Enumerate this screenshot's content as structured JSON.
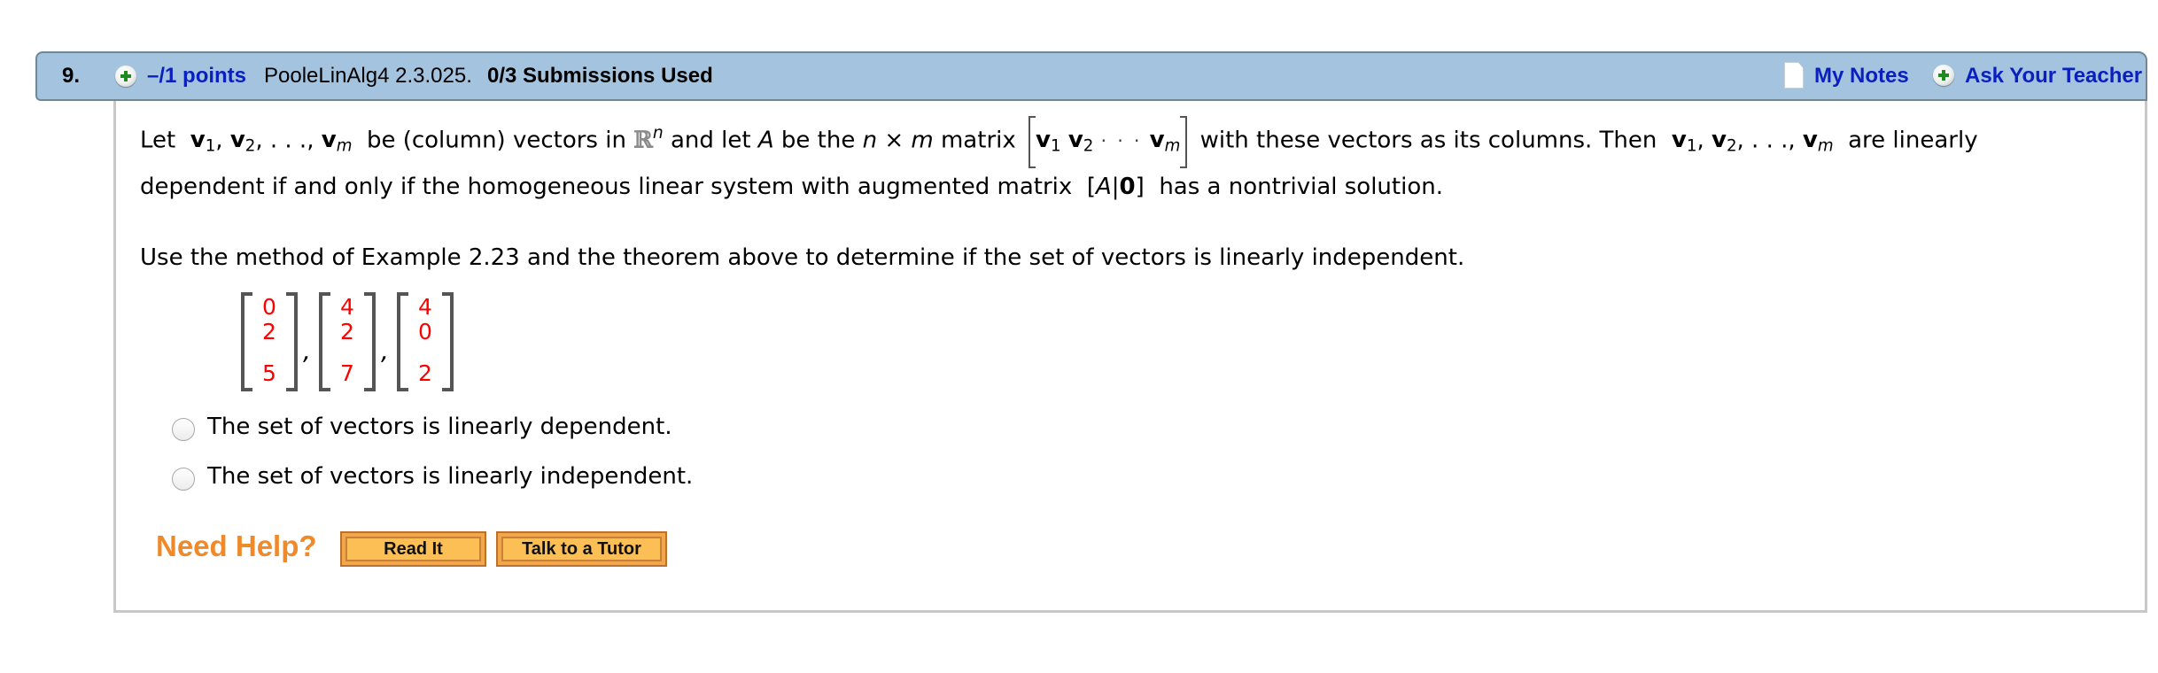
{
  "question": {
    "number": "9.",
    "points": "–/1 points",
    "reference": "PooleLinAlg4 2.3.025.",
    "submissions": "0/3 Submissions Used",
    "my_notes": "My Notes",
    "ask_teacher": "Ask Your Teacher"
  },
  "body": {
    "l1": {
      "let": "Let",
      "v": "v",
      "sub1": "1",
      "sub2": "2",
      "subm": "m",
      "comma": ",",
      "ellipsis": ". . .",
      "be_column": "be (column) vectors in",
      "R": "ℝ",
      "n": "n",
      "and_let": "and let",
      "A": "A",
      "be_the": "be the",
      "n2": "n",
      "times": "×",
      "m": "m",
      "matrix": "matrix",
      "cdots": "· · ·",
      "with_these": "with these vectors as its columns. Then",
      "are_linearly": "are linearly"
    },
    "l2": {
      "text1": "dependent if and only if the homogeneous linear system with augmented matrix",
      "open": "[",
      "A": "A",
      "bar": "|",
      "zero": "0",
      "close": "]",
      "text2": "has a nontrivial solution."
    },
    "l3": "Use the method of Example 2.23 and the theorem above to determine if the set of vectors is linearly independent.",
    "vectors": [
      [
        "0",
        "2",
        "5"
      ],
      [
        "4",
        "2",
        "7"
      ],
      [
        "4",
        "0",
        "2"
      ]
    ],
    "vector_separator": ",",
    "options": [
      {
        "label": "The set of vectors is linearly dependent.",
        "selected": false
      },
      {
        "label": "The set of vectors is linearly independent.",
        "selected": false
      }
    ]
  },
  "help": {
    "label": "Need Help?",
    "read_it": "Read It",
    "tutor": "Talk to a Tutor"
  },
  "colors": {
    "header_bg": "#a3c3de",
    "link": "#0a1fbf",
    "vector_entry": "#ff0000",
    "need_help": "#ef8a2a",
    "button": "#fbbf55"
  }
}
